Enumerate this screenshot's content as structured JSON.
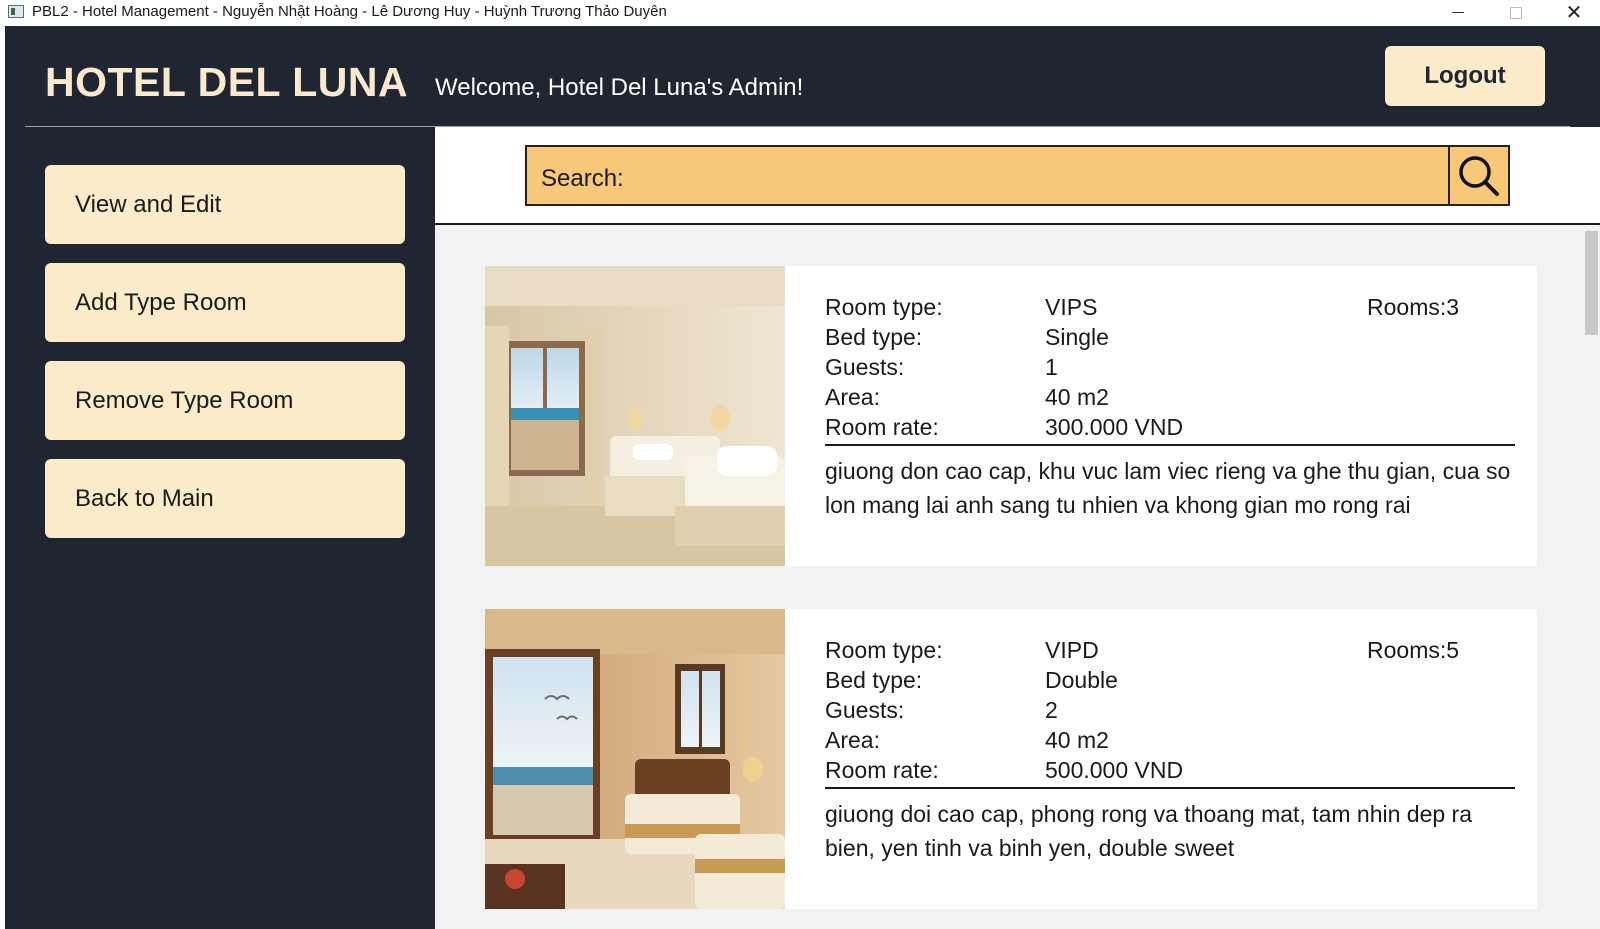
{
  "window": {
    "title": "PBL2 - Hotel Management - Nguyễn Nhật Hoàng - Lê Dương Huy - Huỳnh Trương Thảo Duyên"
  },
  "header": {
    "brand": "HOTEL DEL LUNA",
    "welcome": "Welcome, Hotel Del Luna's Admin!",
    "logout_label": "Logout"
  },
  "sidebar": {
    "items": [
      {
        "label": "View and Edit"
      },
      {
        "label": "Add Type Room"
      },
      {
        "label": "Remove Type Room"
      },
      {
        "label": "Back to Main"
      }
    ]
  },
  "search": {
    "label": "Search:",
    "icon": "search-icon"
  },
  "labels": {
    "room_type": "Room type:",
    "bed_type": "Bed type:",
    "guests": "Guests:",
    "area": "Area:",
    "room_rate": "Room rate:"
  },
  "rooms": [
    {
      "room_type": "VIPS",
      "rooms": "Rooms:3",
      "bed_type": "Single",
      "guests": "1",
      "area": "40 m2",
      "room_rate": "300.000 VND",
      "description": "giuong don cao cap, khu vuc lam viec rieng va ghe thu gian, cua so lon mang lai anh sang tu nhien va khong gian mo rong rai"
    },
    {
      "room_type": "VIPD",
      "rooms": "Rooms:5",
      "bed_type": "Double",
      "guests": "2",
      "area": "40 m2",
      "room_rate": "500.000 VND",
      "description": "giuong doi cao cap, phong rong va thoang mat, tam nhin dep ra bien, yen tinh va binh yen, double sweet"
    }
  ],
  "colors": {
    "sidebar_bg": "#1f2631",
    "button_bg": "#fcebc8",
    "search_bg": "#f7c878",
    "brand_text": "#fae9cc"
  }
}
